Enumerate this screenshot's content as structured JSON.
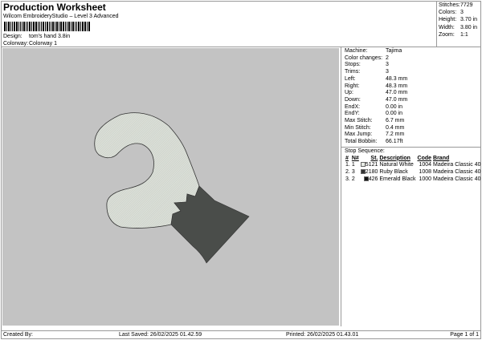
{
  "header": {
    "title": "Production Worksheet",
    "subtitle": "Wilcom EmbroideryStudio – Level 3 Advanced",
    "design_label": "Design:",
    "design_value": "tom's hand 3.8in",
    "colorway_label": "Colorway:",
    "colorway_value": "Colorway 1"
  },
  "stats": [
    {
      "k": "Stitches:",
      "v": "7729"
    },
    {
      "k": "Colors:",
      "v": "3"
    },
    {
      "k": "Height:",
      "v": "3.70 in"
    },
    {
      "k": "Width:",
      "v": "3.80 in"
    },
    {
      "k": "Zoom:",
      "v": "1:1"
    }
  ],
  "info": [
    {
      "k": "Machine:",
      "v": "Tajima"
    },
    {
      "k": "Color changes:",
      "v": "2"
    },
    {
      "k": "Stops:",
      "v": "3"
    },
    {
      "k": "Trims:",
      "v": "3"
    },
    {
      "k": "Left:",
      "v": "48.3 mm"
    },
    {
      "k": "Right:",
      "v": "48.3 mm"
    },
    {
      "k": "Up:",
      "v": "47.0 mm"
    },
    {
      "k": "Down:",
      "v": "47.0 mm"
    },
    {
      "k": "EndX:",
      "v": "0.00 in"
    },
    {
      "k": "EndY:",
      "v": "0.00 in"
    },
    {
      "k": "Max Stitch:",
      "v": "6.7 mm"
    },
    {
      "k": "Min Stitch:",
      "v": "0.4 mm"
    },
    {
      "k": "Max Jump:",
      "v": "7.2 mm"
    },
    {
      "k": "Total Bobbin:",
      "v": "66.17ft"
    }
  ],
  "sequence": {
    "title": "Stop Sequence:",
    "headers": [
      "#",
      "N#",
      "St.",
      "Description",
      "Code",
      "Brand"
    ],
    "rows": [
      {
        "n": "1.",
        "nn": "1",
        "color": "#e8ece6",
        "st": "5121",
        "desc": "Natural White",
        "code": "1004",
        "brand": "Madeira Classic 40"
      },
      {
        "n": "2.",
        "nn": "3",
        "color": "#333333",
        "st": "2180",
        "desc": "Ruby Black",
        "code": "1008",
        "brand": "Madeira Classic 40"
      },
      {
        "n": "3.",
        "nn": "2",
        "color": "#111111",
        "st": "426",
        "desc": "Emerald Black",
        "code": "1000",
        "brand": "Madeira Classic 40"
      }
    ]
  },
  "design_colors": {
    "light": "#dde1da",
    "dark": "#4a4d4a",
    "background": "#c3c3c3"
  },
  "footer": {
    "created": "Created By:",
    "saved": "Last Saved: 26/02/2025 01.42.59",
    "printed": "Printed: 26/02/2025 01.43.01",
    "page": "Page 1 of 1"
  }
}
